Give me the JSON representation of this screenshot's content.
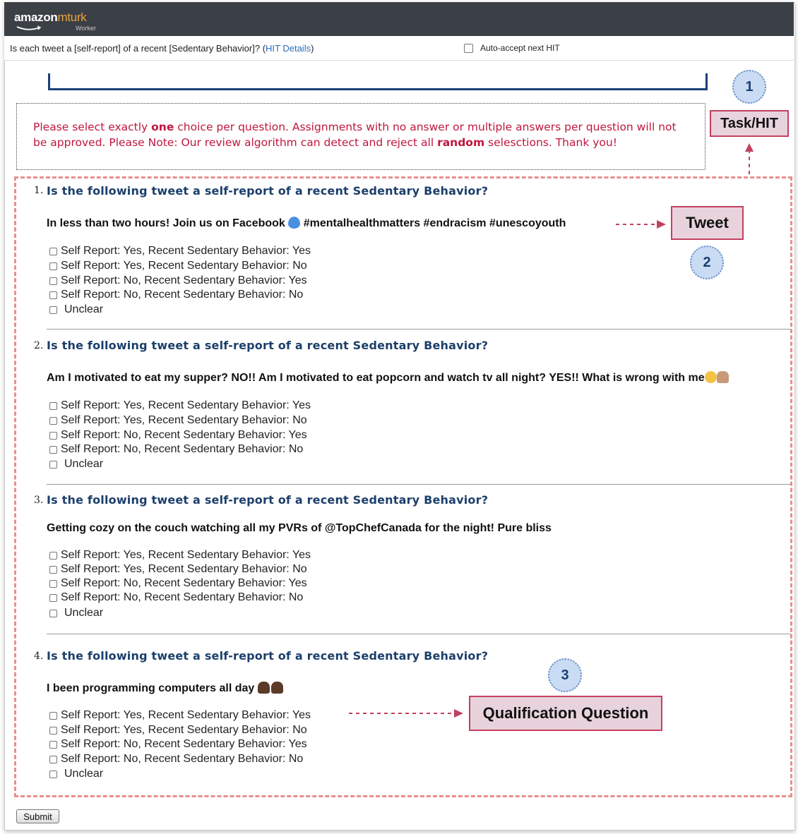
{
  "brand": {
    "name": "amazon",
    "product": "mturk",
    "sub": "Worker"
  },
  "hit_bar": {
    "question_prefix": "Is each tweet a [self-report] of a recent [Sedentary Behavior]? (",
    "details_link": "HIT Details",
    "question_suffix": ")",
    "auto_accept_label": "Auto-accept next HIT"
  },
  "instructions": {
    "p1": "Please select exactly ",
    "b1": "one",
    "p2": " choice per question. Assignments with no answer or multiple answers per question will not be approved. Please Note: Our review algorithm can detect and reject all ",
    "b2": "random",
    "p3": " selesctions. Thank you!"
  },
  "question_text": "Is the following tweet a self-report of a recent Sedentary Behavior?",
  "questions": [
    {
      "num": "1.",
      "tweet": "In less than two hours! Join us on Facebook",
      "tweet_tail": " #mentalhealthmatters #endracism #unescoyouth"
    },
    {
      "num": "2.",
      "tweet": "Am I motivated to eat my supper? NO!! Am I motivated to eat popcorn and watch tv all night? YES!! What is wrong with me"
    },
    {
      "num": "3.",
      "tweet": "Getting cozy on the couch watching all my PVRs of @TopChefCanada for the night! Pure bliss"
    },
    {
      "num": "4.",
      "tweet": "I been programming computers all day"
    }
  ],
  "options": [
    "Self Report: Yes, Recent Sedentary Behavior: Yes",
    "Self Report: Yes, Recent Sedentary Behavior: No",
    "Self Report: No, Recent Sedentary Behavior: Yes",
    "Self Report: No, Recent Sedentary Behavior: No",
    "Unclear"
  ],
  "annotations": {
    "task_label": "Task/HIT",
    "tweet_label": "Tweet",
    "qual_label": "Qualification Question",
    "n1": "1",
    "n2": "2",
    "n3": "3"
  },
  "submit_label": "Submit",
  "colors": {
    "instruction_red": "#c0163f",
    "question_blue": "#1c3f6b",
    "annotation_pink": "#c2415e",
    "annotation_fill": "#e8d3dc",
    "circle_fill": "#c9dcf3",
    "region_dash": "#e98e8e",
    "topbar": "#3b3f46",
    "link_blue": "#2a6ebb"
  }
}
